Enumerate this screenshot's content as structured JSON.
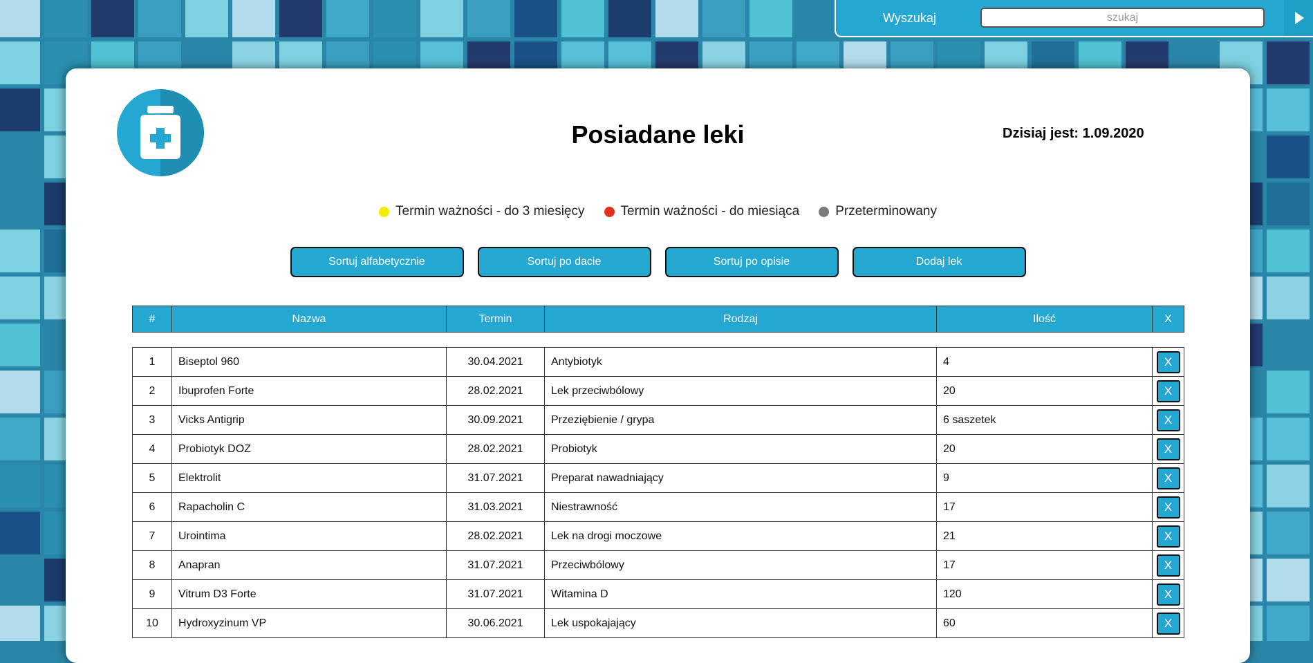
{
  "search": {
    "label": "Wyszukaj",
    "placeholder": "szukaj"
  },
  "header": {
    "title": "Posiadane leki",
    "today": "Dzisiaj jest: 1.09.2020"
  },
  "legend": [
    {
      "label": "Termin ważności - do 3 miesięcy",
      "color": "#f5ec00"
    },
    {
      "label": "Termin ważności - do miesiąca",
      "color": "#e3301a"
    },
    {
      "label": "Przeterminowany",
      "color": "#7a7a7a"
    }
  ],
  "buttons": [
    "Sortuj alfabetycznie",
    "Sortuj po dacie",
    "Sortuj po opisie",
    "Dodaj lek"
  ],
  "table": {
    "columns": [
      "#",
      "Nazwa",
      "Termin",
      "Rodzaj",
      "Ilość",
      "X"
    ],
    "delete_label": "X",
    "rows": [
      [
        "1",
        "Biseptol 960",
        "30.04.2021",
        "Antybiotyk",
        "4"
      ],
      [
        "2",
        "Ibuprofen Forte",
        "28.02.2021",
        "Lek przeciwbólowy",
        "20"
      ],
      [
        "3",
        "Vicks Antigrip",
        "30.09.2021",
        "Przeziębienie / grypa",
        "6 saszetek"
      ],
      [
        "4",
        "Probiotyk DOZ",
        "28.02.2021",
        "Probiotyk",
        "20"
      ],
      [
        "5",
        "Elektrolit",
        "31.07.2021",
        "Preparat nawadniający",
        "9"
      ],
      [
        "6",
        "Rapacholin C",
        "31.03.2021",
        "Niestrawność",
        "17"
      ],
      [
        "7",
        "Urointima",
        "28.02.2021",
        "Lek na drogi moczowe",
        "21"
      ],
      [
        "8",
        "Anapran",
        "31.07.2021",
        "Przeciwbólowy",
        "17"
      ],
      [
        "9",
        "Vitrum D3 Forte",
        "31.07.2021",
        "Witamina D",
        "120"
      ],
      [
        "10",
        "Hydroxyzinum VP",
        "30.06.2021",
        "Lek uspokajający",
        "60"
      ]
    ]
  },
  "colors": {
    "accent": "#24a8d1",
    "accent_dark": "#1f92b7",
    "background": "#2a86a8"
  },
  "icons": {
    "logo": "medicine-bottle-icon",
    "search_submit": "play-arrow-icon"
  }
}
